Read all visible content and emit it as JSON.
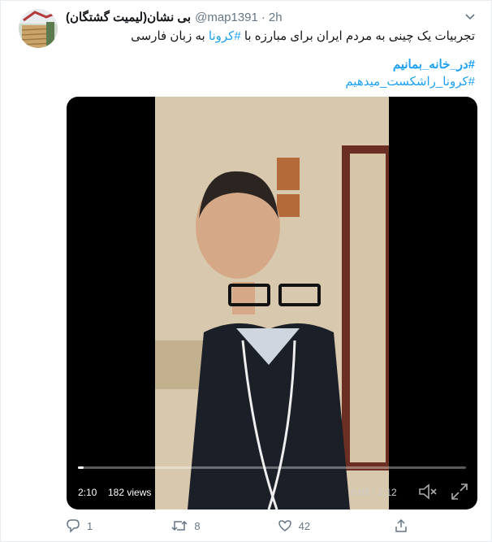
{
  "tweet": {
    "display_name": "بی نشان(لیمیت گشتگان)",
    "handle": "@map1391",
    "separator": "·",
    "time": "2h",
    "text_before": "تجربیات یک چینی به مردم ایران برای مبارزه با ",
    "text_link": "#کرونا",
    "text_after": " به زبان فارسی",
    "hashtags": [
      "#در_خانه_بمانیم",
      "#کرونا_راشکست_میدهیم"
    ]
  },
  "video": {
    "duration": "2:10",
    "views": "182 views",
    "time_readout": "0:02 / 2:12",
    "progress": 0.015
  },
  "actions": {
    "reply_count": "1",
    "retweet_count": "8",
    "like_count": "42"
  },
  "icons": [
    "chevron-down-icon",
    "reply-icon",
    "retweet-icon",
    "like-icon",
    "share-icon",
    "volume-muted-icon",
    "fullscreen-icon"
  ],
  "colors": {
    "link": "#1da1f2",
    "muted": "#657786",
    "border": "#e6ecf0"
  }
}
